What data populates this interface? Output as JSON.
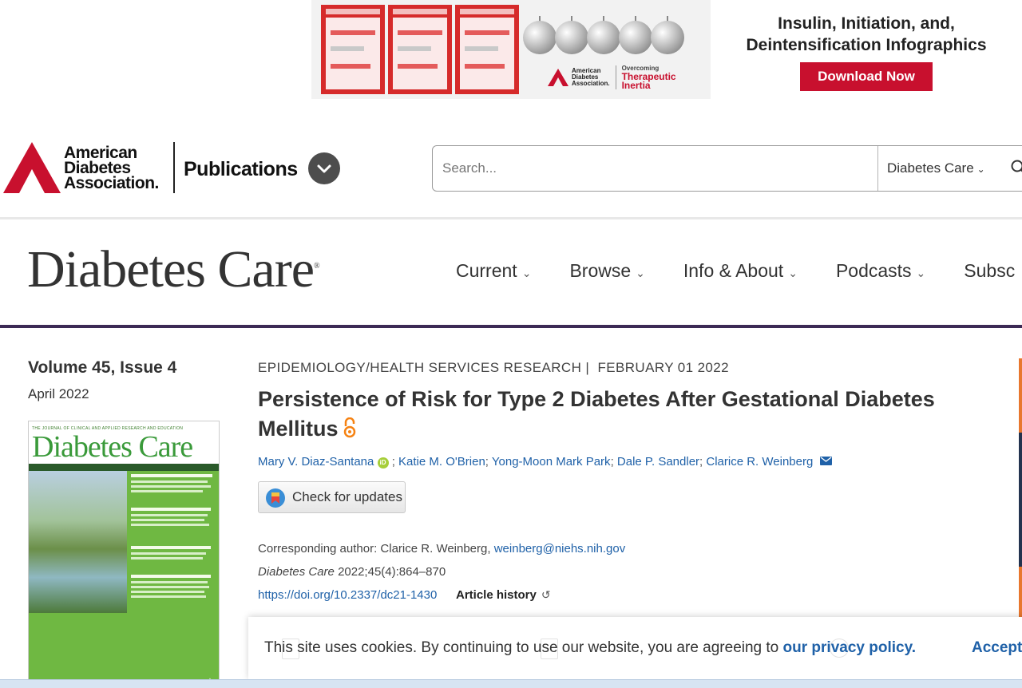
{
  "ad": {
    "headline": "Insulin, Initiation, and, Deintensification Infographics",
    "button_label": "Download Now",
    "sponsor_line1": "American",
    "sponsor_line2": "Diabetes",
    "sponsor_line3": "Association.",
    "tagline_top": "Overcoming",
    "tagline_main1": "Therapeutic",
    "tagline_main2": "Inertia"
  },
  "header": {
    "logo_line1": "American",
    "logo_line2": "Diabetes",
    "logo_line3": "Association.",
    "publications_label": "Publications",
    "search_placeholder": "Search...",
    "search_scope": "Diabetes Care"
  },
  "journal": {
    "title": "Diabetes Care",
    "nav": [
      {
        "label": "Current"
      },
      {
        "label": "Browse"
      },
      {
        "label": "Info & About"
      },
      {
        "label": "Podcasts"
      },
      {
        "label": "Subsc"
      }
    ]
  },
  "sidebar": {
    "volume": "Volume 45, Issue 4",
    "issue_date": "April 2022",
    "cover_name": "Diabetes Care"
  },
  "article": {
    "section": "EPIDEMIOLOGY/HEALTH SERVICES RESEARCH",
    "date": "FEBRUARY 01 2022",
    "title": "Persistence of Risk for Type 2 Diabetes After Gestational Diabetes Mellitus",
    "authors": [
      "Mary V. Diaz-Santana",
      "Katie M. O'Brien",
      "Yong-Moon Mark Park",
      "Dale P. Sandler",
      "Clarice R. Weinberg"
    ],
    "check_updates_label": "Check for updates",
    "corresponding_prefix": "Corresponding author: Clarice R. Weinberg,",
    "corresponding_email": "weinberg@niehs.nih.gov",
    "citation_journal": "Diabetes Care",
    "citation_rest": "2022;45(4):864–870",
    "doi": "https://doi.org/10.2337/dc21-1430",
    "history_label": "Article history"
  },
  "cookie": {
    "text": "This site uses cookies. By continuing to use our website, you are agreeing to",
    "link": "our privacy policy.",
    "accept": "Accept"
  },
  "colors": {
    "brand_red": "#c8102e",
    "link_blue": "#1f61a8",
    "journal_purple": "#3c2a55",
    "cover_green": "#6fb842"
  }
}
